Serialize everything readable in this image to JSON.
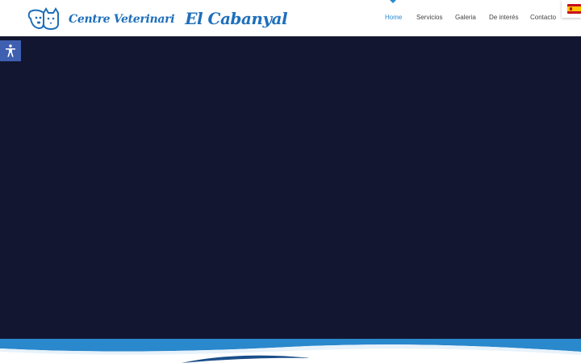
{
  "header": {
    "brand_sub": "Centre Veterinari",
    "brand_main": "El Cabanyal",
    "logo_icon": "pet-dog-cat-icon"
  },
  "nav": {
    "items": [
      {
        "label": "Home",
        "active": true
      },
      {
        "label": "Servicios",
        "active": false
      },
      {
        "label": "Galeria",
        "active": false
      },
      {
        "label": "De interés",
        "active": false
      },
      {
        "label": "Contacto",
        "active": false
      }
    ]
  },
  "language": {
    "current": "Spanish",
    "icon": "spain-flag-icon"
  },
  "accessibility": {
    "icon": "accessibility-icon"
  },
  "colors": {
    "brand": "#1e6fba",
    "nav_active": "#2a8ad0",
    "hero_background": "#131630",
    "accessibility_button": "#3f5fb0",
    "wave_blue": "#2a88cc"
  }
}
